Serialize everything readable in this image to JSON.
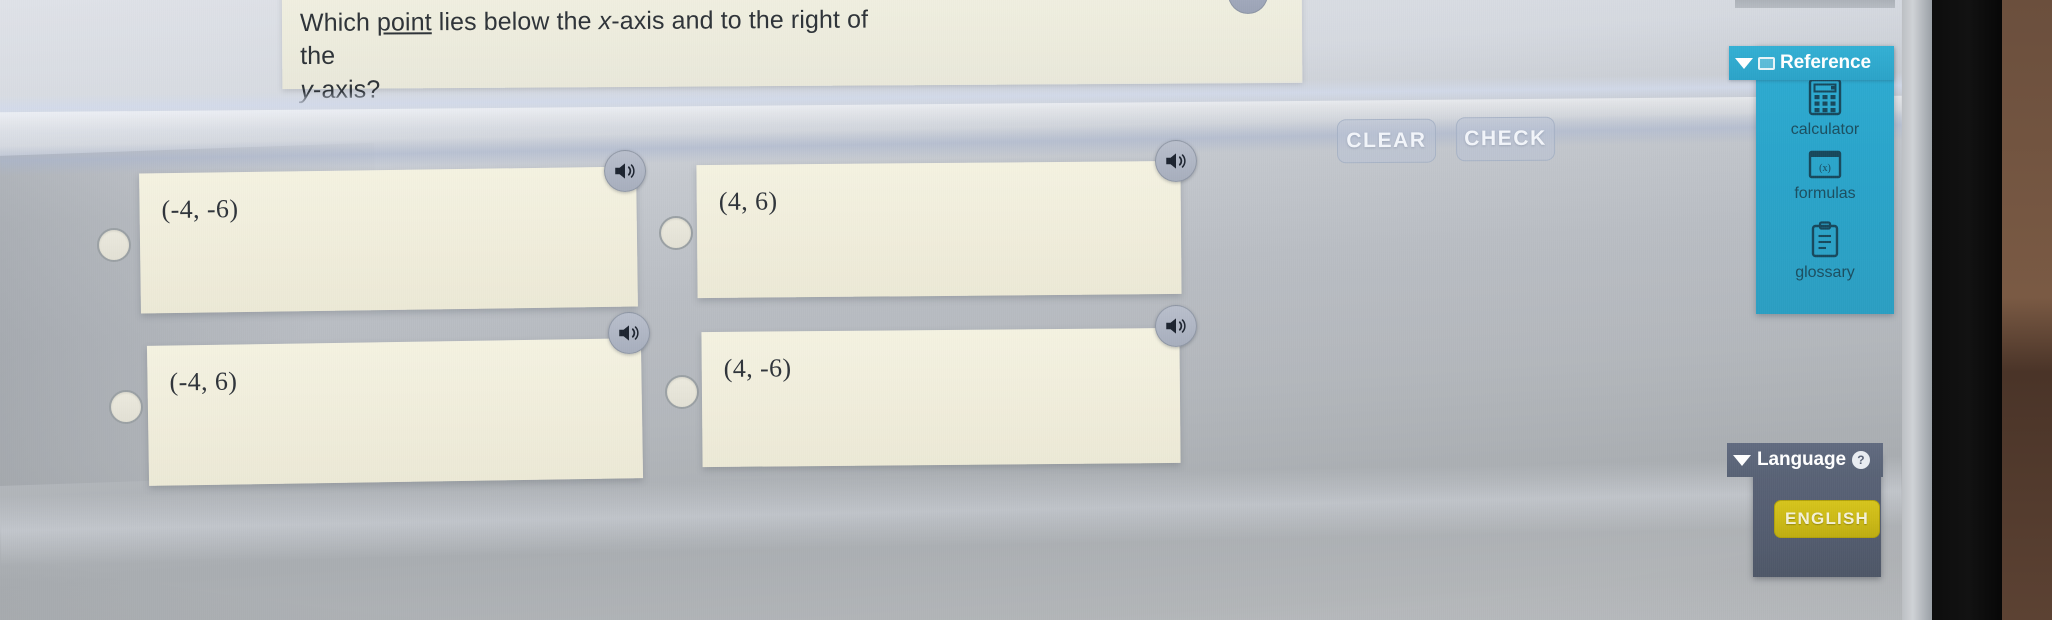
{
  "question": {
    "prefix": "Which ",
    "underlined_word": "point",
    "suffix_line1": " lies below the ",
    "x_axis": "x",
    "mid": "-axis and to the right of the",
    "y_axis": "y",
    "suffix_line2": "-axis?",
    "full_text": "Which point lies below the x-axis and to the right of the y-axis?"
  },
  "toolbar": {
    "clear_label": "CLEAR",
    "check_label": "CHECK"
  },
  "options": [
    {
      "label": "(-4, -6)",
      "selected": false,
      "audio_icon": "speaker-icon"
    },
    {
      "label": "(4, 6)",
      "selected": false,
      "audio_icon": "speaker-icon"
    },
    {
      "label": "(-4, 6)",
      "selected": false,
      "audio_icon": "speaker-icon"
    },
    {
      "label": "(4, -6)",
      "selected": false,
      "audio_icon": "speaker-icon"
    }
  ],
  "reference": {
    "title": "Reference",
    "header_icon": "book-icon",
    "caret_icon": "chevron-down-icon",
    "tools": [
      {
        "label": "calculator",
        "icon": "calculator-icon"
      },
      {
        "label": "formulas",
        "icon": "formulas-icon"
      },
      {
        "label": "glossary",
        "icon": "clipboard-icon"
      }
    ]
  },
  "language": {
    "title": "Language",
    "help_icon": "question-mark-icon",
    "caret_icon": "chevron-down-icon",
    "selected": "ENGLISH"
  },
  "colors": {
    "reference_panel": "#2aa5cb",
    "language_panel": "#555e72",
    "english_button": "#cbb916",
    "card_background": "#f0eddb",
    "page_background": "#b9bdc3",
    "action_button": "#bac3d5"
  }
}
